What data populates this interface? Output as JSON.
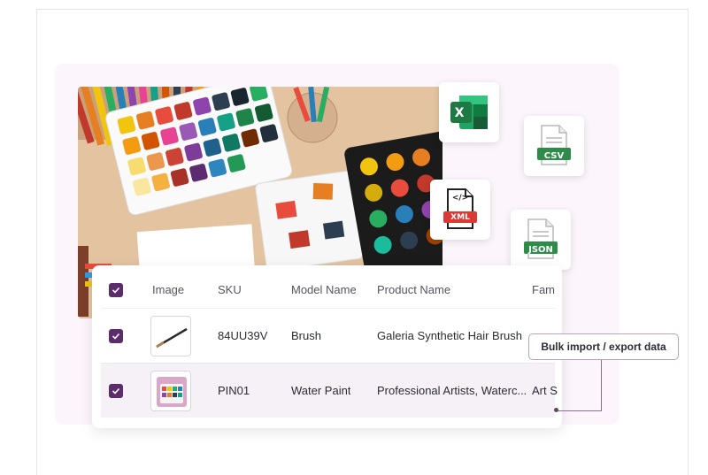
{
  "table": {
    "headers": [
      "Image",
      "SKU",
      "Model Name",
      "Product Name",
      "Fam"
    ],
    "rows": [
      {
        "sku": "84UU39V",
        "model": "Brush",
        "product": "Galeria Synthetic Hair Brush",
        "family": ""
      },
      {
        "sku": "PIN01",
        "model": "Water Paint",
        "product": "Professional Artists, Waterc...",
        "family": "Art S"
      }
    ]
  },
  "formats": {
    "excel": "X",
    "csv": "CSV",
    "xml": "XML",
    "xml_tag": "</>",
    "json": "JSON"
  },
  "callout": {
    "label": "Bulk import / export data"
  },
  "colors": {
    "accent": "#5b2d6a",
    "excel_green": "#1d7a43",
    "file_green": "#2e8b4a",
    "xml_red": "#d93a33",
    "panel_pink": "#fcf5fb"
  }
}
